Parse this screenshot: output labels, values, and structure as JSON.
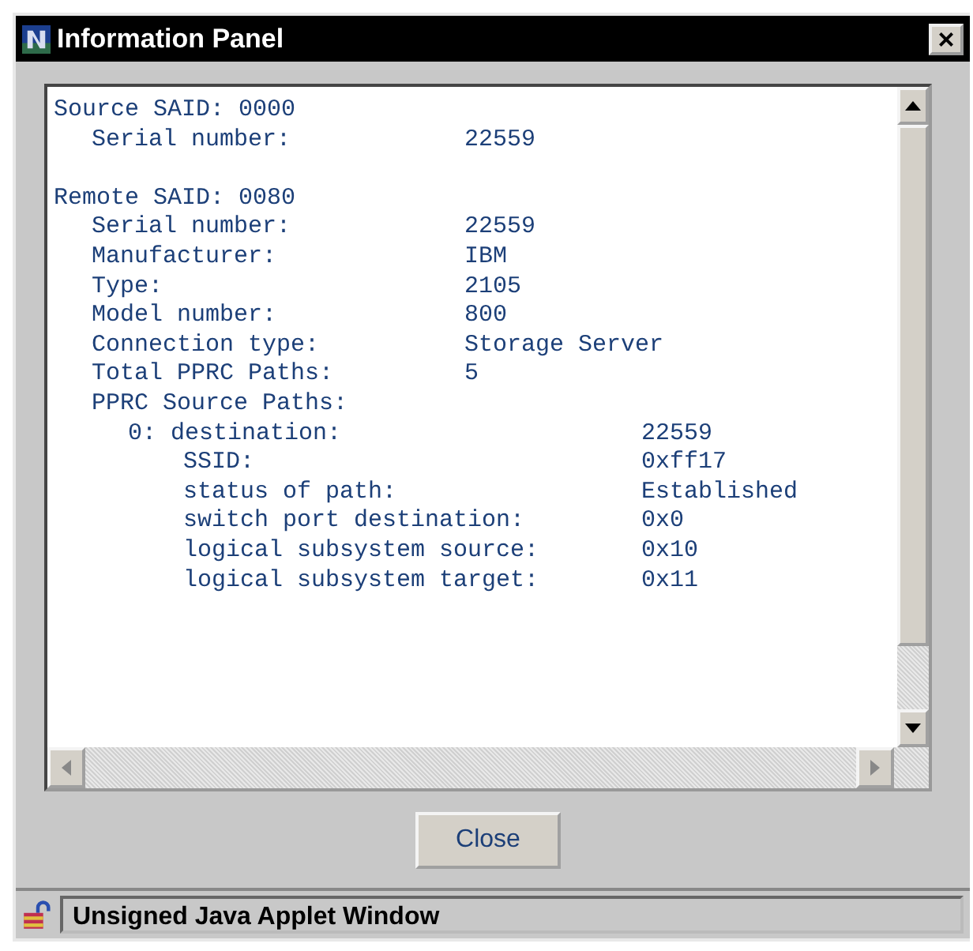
{
  "window": {
    "title": "Information Panel",
    "close_glyph": "×"
  },
  "lines": [
    {
      "label": "Source SAID: 0000",
      "children": [
        {
          "label": "Serial number:",
          "value": "22559"
        }
      ]
    },
    {
      "label": "Remote SAID: 0080",
      "children": [
        {
          "label": "Serial number:",
          "value": "22559"
        },
        {
          "label": "Manufacturer:",
          "value": "IBM"
        },
        {
          "label": "Type:",
          "value": "2105"
        },
        {
          "label": "Model number:",
          "value": "800"
        },
        {
          "label": "Connection type:",
          "value": "Storage Server"
        },
        {
          "label": "Total PPRC Paths:",
          "value": "5"
        },
        {
          "label": "PPRC Source Paths:",
          "children": [
            {
              "label": "0: destination:",
              "value": "22559",
              "children": [
                {
                  "label": "SSID:",
                  "value": "0xff17"
                },
                {
                  "label": "status of path:",
                  "value": "Established"
                },
                {
                  "label": "switch port destination:",
                  "value": "0x0"
                },
                {
                  "label": "logical subsystem source:",
                  "value": "0x10"
                },
                {
                  "label": "logical subsystem target:",
                  "value": "0x11"
                }
              ]
            }
          ]
        }
      ]
    }
  ],
  "buttons": [
    "Close"
  ],
  "status_bar": {
    "text": "Unsigned Java Applet Window"
  }
}
